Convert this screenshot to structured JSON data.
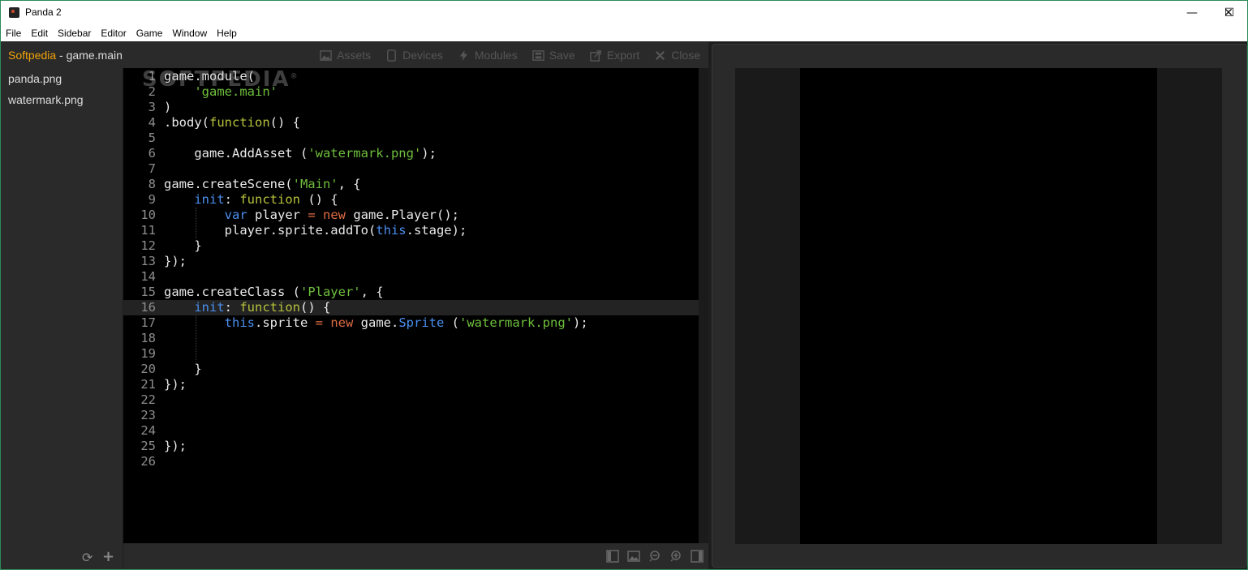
{
  "window": {
    "title": "Panda 2",
    "minimize": "—",
    "maximize": "☐",
    "close": "✕"
  },
  "menu": [
    "File",
    "Edit",
    "Sidebar",
    "Editor",
    "Game",
    "Window",
    "Help"
  ],
  "toolbar": {
    "project": "Softpedia",
    "separator": " - ",
    "module": "game.main",
    "buttons": [
      {
        "label": "Assets",
        "icon": "image-icon"
      },
      {
        "label": "Devices",
        "icon": "device-icon"
      },
      {
        "label": "Modules",
        "icon": "bolt-icon"
      },
      {
        "label": "Save",
        "icon": "save-icon"
      },
      {
        "label": "Export",
        "icon": "export-icon"
      },
      {
        "label": "Close",
        "icon": "close-icon"
      }
    ]
  },
  "sidebar": {
    "files": [
      "panda.png",
      "watermark.png"
    ]
  },
  "editor": {
    "active_line": 16,
    "lines": [
      "game.module(",
      "    'game.main'",
      ")",
      ".body(function() {",
      "",
      "    game.AddAsset ('watermark.png');",
      "",
      "game.createScene('Main', {",
      "    init: function () {",
      "        var player = new game.Player();",
      "        player.sprite.addTo(this.stage);",
      "    }",
      "});",
      "",
      "game.createClass ('Player', {",
      "    init: function() {",
      "        this.sprite = new game.Sprite ('watermark.png');",
      "",
      "",
      "    }",
      "});",
      "",
      "",
      "",
      "});",
      ""
    ]
  },
  "watermark": {
    "text": "SOFTPEDIA",
    "mark": "®"
  },
  "colors": {
    "accent": "#f0a30a",
    "keyword": "#4a8ff0",
    "function": "#b7c23b",
    "string": "#6fbf3c",
    "operator": "#e06c44"
  }
}
